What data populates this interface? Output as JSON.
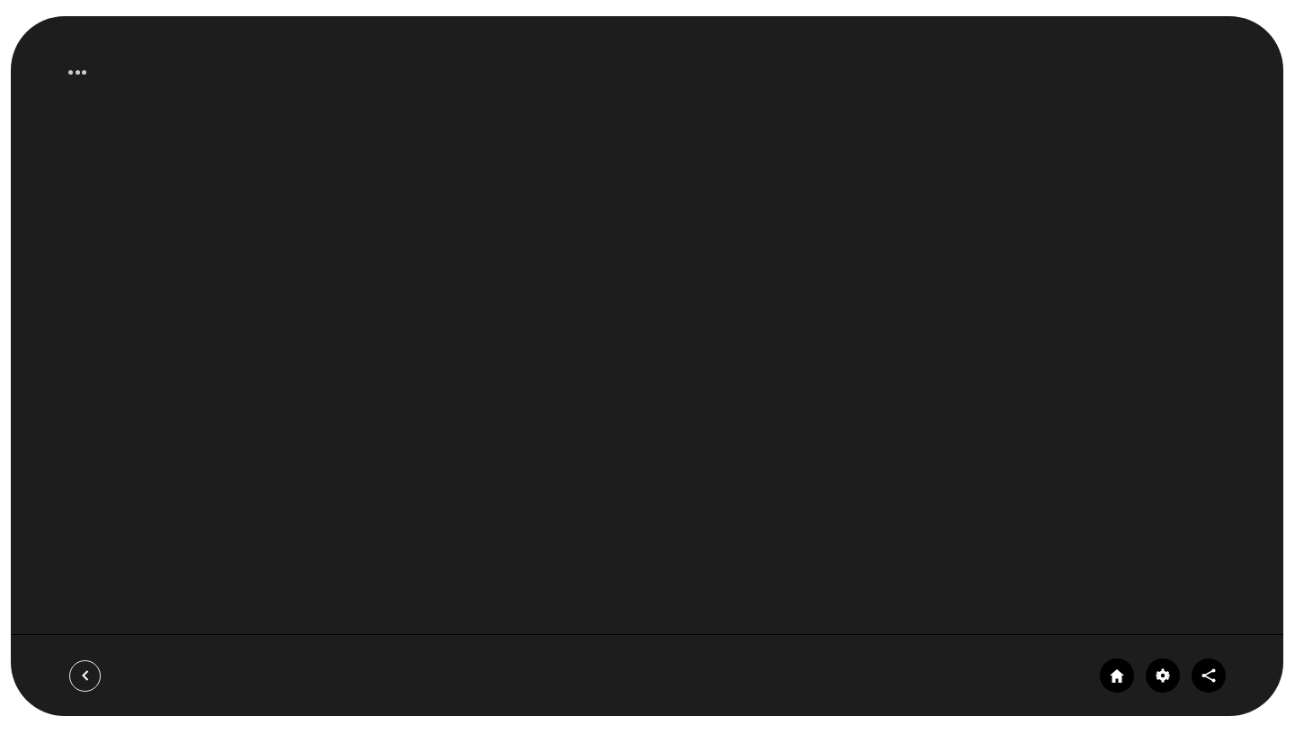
{
  "toolbar": {
    "back": {
      "kind": "back"
    },
    "buttons": [
      {
        "kind": "home"
      },
      {
        "kind": "settings"
      },
      {
        "kind": "share"
      }
    ]
  }
}
